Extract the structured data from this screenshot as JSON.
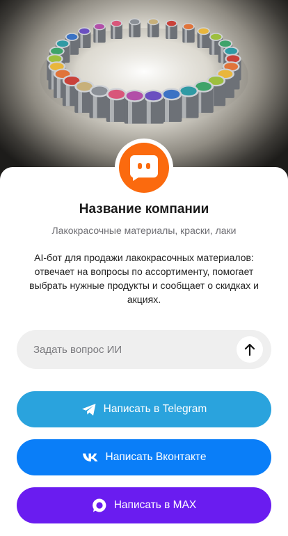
{
  "hero": {
    "image": "paint-cans-ring-photo"
  },
  "company": {
    "avatar_icon": "chat-bot-face-icon",
    "avatar_color": "#fb6a0e",
    "name": "Название компании",
    "subtitle": "Лакокрасочные материалы, краски, лаки",
    "description": "AI-бот для продажи лакокрасочных материалов: отвечает на вопросы по ассортименту, помогает выбрать нужные продукты и сообщает о скидках и акциях."
  },
  "ask": {
    "placeholder": "Задать вопрос ИИ",
    "send_icon": "arrow-up-icon"
  },
  "buttons": {
    "telegram": {
      "label": "Написать в Telegram",
      "icon": "telegram-icon",
      "color": "#2aa3dd"
    },
    "vk": {
      "label": "Написать Вконтакте",
      "icon": "vk-icon",
      "color": "#0a7ef8"
    },
    "max": {
      "label": "Написать в MAX",
      "icon": "max-icon",
      "color": "#6a1cf0"
    }
  }
}
